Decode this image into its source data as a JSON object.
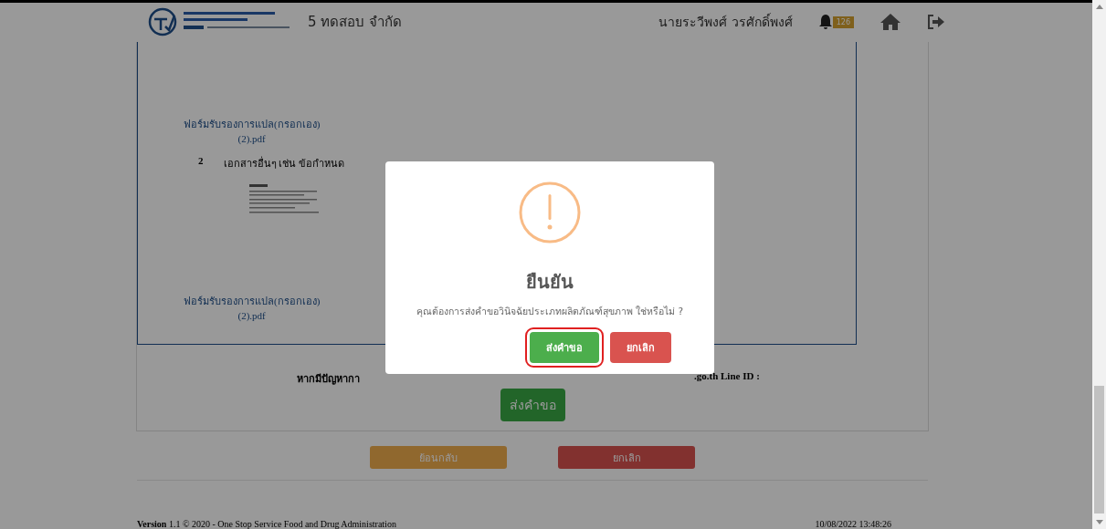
{
  "header": {
    "company": "5 ทดสอบ จำกัด",
    "user": "นายระวีพงศ์ วรศักดิ์พงศ์",
    "notification_count": "126"
  },
  "documents": [
    {
      "kind": "link",
      "lines": [
        "ฟอร์มรับรองการแปล(กรอกเอง)",
        "(2).pdf"
      ]
    },
    {
      "kind": "item",
      "number": "2",
      "text": "เอกสารอื่นๆ เช่น ข้อกำหนด"
    },
    {
      "kind": "thumbnail"
    },
    {
      "kind": "link",
      "lines": [
        "ฟอร์มรับรองการแปล(กรอกเอง)",
        "(2).pdf"
      ]
    }
  ],
  "contact": {
    "left": "หากมีปัญหากา",
    "right": ".go.th Line ID :"
  },
  "submit_button": "ส่งคำขอ",
  "actions": [
    {
      "label": "ย้อนกลับ",
      "kind": "back"
    },
    {
      "label": "ยกเลิก",
      "kind": "cancel"
    }
  ],
  "footer": {
    "version": "**Version** 1.1 © 2020 - One Stop Service Food and Drug Administration",
    "timestamp": "10/08/2022 13:48:26"
  },
  "dialog": {
    "title": "ยืนยัน",
    "message": "คุณต้องการส่งคำขอวินิจฉัยประเภทผลิตภัณฑ์สุขภาพ ใช่หรือไม่ ?",
    "buttons": [
      {
        "label": "ส่งคำขอ",
        "kind": "confirm",
        "selected": true
      },
      {
        "label": "ยกเลิก",
        "kind": "cancel",
        "selected": false
      }
    ]
  }
}
